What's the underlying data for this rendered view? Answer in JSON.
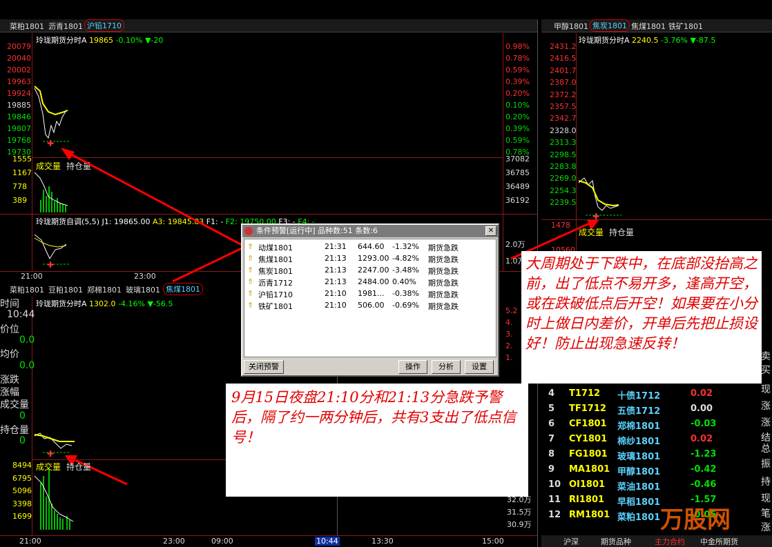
{
  "top_left_tabs": [
    "菜粕1801",
    "沥青1801",
    "沪铅1710"
  ],
  "top_right_tabs": [
    "甲醇1801",
    "焦炭1801",
    "焦煤1801",
    "铁矿1801"
  ],
  "bottom_left_tabs": [
    "菜粕1801",
    "豆粕1801",
    "郑棉1801",
    "玻璃1801",
    "焦煤1801"
  ],
  "chart_tl": {
    "title": "玲珑期货分时A",
    "price": "19865",
    "change": "-0.10%",
    "delta": "▼-20",
    "left_axis": [
      "20079",
      "20040",
      "20002",
      "19963",
      "19924",
      "19885",
      "19846",
      "19807",
      "19768",
      "19730"
    ],
    "right_axis": [
      "0.98%",
      "0.78%",
      "0.59%",
      "0.39%",
      "0.20%",
      "0.10%",
      "0.20%",
      "0.39%",
      "0.59%",
      "0.78%"
    ],
    "vol_left": [
      "1555",
      "1167",
      "778",
      "389"
    ],
    "vol_right": [
      "37082",
      "36785",
      "36489",
      "36192"
    ],
    "vol_label": "成交量",
    "oi_label": "持仓量",
    "sub_title": "玲珑期货自调(5,5)",
    "sub_j1": "J1: 19865.00",
    "sub_a3": "A3: 19845.83",
    "sub_f1": "F1: -",
    "sub_f2": "F2: 19750.00",
    "sub_f3": "F3: -",
    "sub_f4": "F4: -",
    "sub_right": [
      "2.0万",
      "1.0万"
    ],
    "time_axis": [
      "21:00",
      "23:00"
    ]
  },
  "chart_tr": {
    "title": "玲珑期货分时A",
    "price": "2240.5",
    "change": "-3.76%",
    "delta": "▼-87.5",
    "left_axis": [
      "2431.2",
      "2416.5",
      "2401.7",
      "2387.0",
      "2372.2",
      "2357.5",
      "2342.7",
      "2328.0",
      "2313.3",
      "2298.5",
      "2283.8",
      "2269.0",
      "2254.3",
      "2239.5"
    ],
    "vol_left": [
      "1478",
      "10560"
    ],
    "vol_label": "成交量",
    "oi_label": "持仓量"
  },
  "chart_bl": {
    "title": "玲珑期货分时A",
    "price": "1302.0",
    "change": "-4.16%",
    "delta": "▼-56.5",
    "side_labels": [
      "时间",
      "10:44",
      "价位",
      "0.0",
      "均价",
      "0.0",
      "涨跌",
      "涨幅",
      "成交量",
      "0",
      "持仓量",
      "0"
    ],
    "vol_left": [
      "8494",
      "6795",
      "5096",
      "3398",
      "1699"
    ],
    "vol_right": [
      "32.0万",
      "31.5万",
      "30.9万"
    ],
    "right_axis": [
      "5.2",
      "4.",
      "3.",
      "2.",
      "1."
    ],
    "vol_label": "成交量",
    "oi_label": "持仓量",
    "time_axis": [
      "21:00",
      "23:00",
      "09:00",
      "10:44",
      "13:30",
      "15:00"
    ]
  },
  "dialog": {
    "title": "条件预警[运行中] 品种数:51  条数:6",
    "close": "✕",
    "rows": [
      {
        "name": "动煤1801",
        "time": "21:31",
        "price": "644.60",
        "pct": "-1.32%",
        "type": "期货急跌"
      },
      {
        "name": "焦煤1801",
        "time": "21:13",
        "price": "1293.00",
        "pct": "-4.82%",
        "type": "期货急跌"
      },
      {
        "name": "焦炭1801",
        "time": "21:13",
        "price": "2247.00",
        "pct": "-3.48%",
        "type": "期货急跌"
      },
      {
        "name": "沥青1712",
        "time": "21:13",
        "price": "2484.00",
        "pct": "0.40%",
        "type": "期货急跌"
      },
      {
        "name": "沪铅1710",
        "time": "21:10",
        "price": "1981...",
        "pct": "-0.38%",
        "type": "期货急跌"
      },
      {
        "name": "铁矿1801",
        "time": "21:10",
        "price": "506.00",
        "pct": "-0.69%",
        "type": "期货急跌"
      }
    ],
    "btn_close_alert": "关闭预警",
    "btn_operate": "操作",
    "btn_analyze": "分析",
    "btn_settings": "设置"
  },
  "note_right": "大周期处于下跌中，在底部没抬高之前，出了低点不易开多，逢高开空，或在跌破低点后开空！如果要在小分时上做日内差价，开单后先把止损设好！防止出现急速反转！",
  "note_bottom": "9月15日夜盘21:10分和21:13分急跌予警后，隔了约一两分钟后，共有3支出了低点信号！",
  "quote_rows": [
    {
      "n": "4",
      "code": "T1712",
      "name": "十债1712",
      "chg": "0.02",
      "color": "#ff3030"
    },
    {
      "n": "5",
      "code": "TF1712",
      "name": "五债1712",
      "chg": "0.00",
      "color": "#ddd"
    },
    {
      "n": "6",
      "code": "CF1801",
      "name": "郑棉1801",
      "chg": "-0.03",
      "color": "#00e000"
    },
    {
      "n": "7",
      "code": "CY1801",
      "name": "棉纱1801",
      "chg": "0.02",
      "color": "#ff3030"
    },
    {
      "n": "8",
      "code": "FG1801",
      "name": "玻璃1801",
      "chg": "-1.23",
      "color": "#00e000"
    },
    {
      "n": "9",
      "code": "MA1801",
      "name": "甲醇1801",
      "chg": "-0.42",
      "color": "#00e000"
    },
    {
      "n": "10",
      "code": "OI1801",
      "name": "菜油1801",
      "chg": "-0.46",
      "color": "#00e000"
    },
    {
      "n": "11",
      "code": "RI1801",
      "name": "早稻1801",
      "chg": "-1.57",
      "color": "#00e000"
    },
    {
      "n": "12",
      "code": "RM1801",
      "name": "菜粕1801",
      "chg": "-0.05",
      "color": "#00e000"
    }
  ],
  "right_edge": [
    "卖",
    "买",
    "现",
    "涨",
    "涨",
    "结",
    "总",
    "振",
    "持",
    "现",
    "笔",
    "涨"
  ],
  "bottom_tabs": [
    "沪深",
    "期货品种",
    "主力合约",
    "中金所期货"
  ],
  "watermark": "万股网"
}
